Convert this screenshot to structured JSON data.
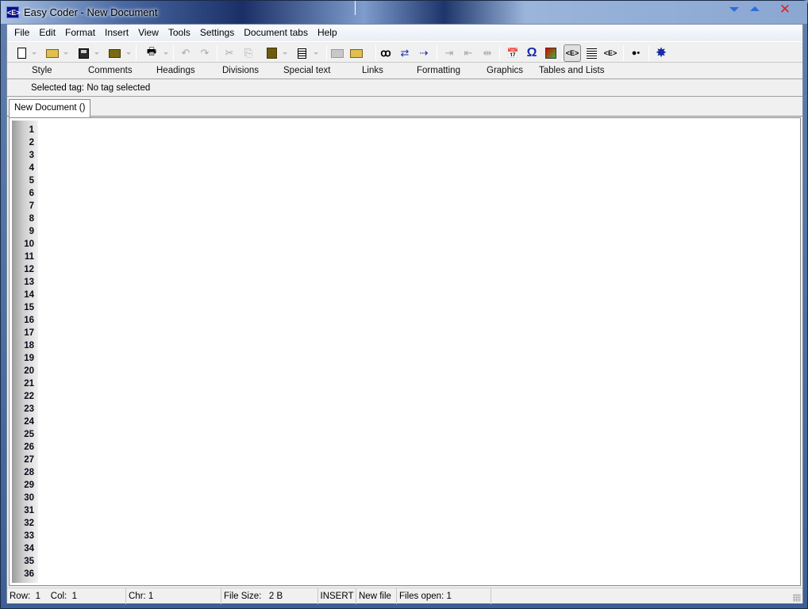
{
  "window": {
    "title": "Easy Coder - New Document",
    "app_icon": "easy-coder-logo-icon",
    "app_icon_text": "<E>",
    "controls": [
      "minimize-icon",
      "maximize-icon",
      "close-icon"
    ],
    "close_glyph": "✕"
  },
  "menu": {
    "items": [
      "File",
      "Edit",
      "Format",
      "Insert",
      "View",
      "Tools",
      "Settings",
      "Document tabs",
      "Help"
    ]
  },
  "toolbar": {
    "buttons": [
      {
        "name": "new-document",
        "icon": "new-document-icon",
        "enabled": true,
        "dropdown": true
      },
      {
        "name": "open",
        "icon": "open-folder-icon",
        "enabled": true,
        "dropdown": true
      },
      {
        "name": "save",
        "icon": "save-floppy-icon",
        "enabled": true,
        "dropdown": true
      },
      {
        "name": "save-to-server",
        "icon": "upload-folder-icon",
        "enabled": true,
        "dropdown": true
      },
      {
        "name": "print",
        "icon": "printer-icon",
        "enabled": true,
        "dropdown": true
      },
      {
        "name": "undo",
        "icon": "undo-icon",
        "enabled": false,
        "glyph": "↶"
      },
      {
        "name": "redo",
        "icon": "redo-icon",
        "enabled": false,
        "glyph": "↷"
      },
      {
        "name": "cut",
        "icon": "scissors-icon",
        "enabled": false,
        "glyph": "✂"
      },
      {
        "name": "copy",
        "icon": "copy-icon",
        "enabled": false,
        "glyph": "⎘"
      },
      {
        "name": "paste",
        "icon": "paste-icon",
        "enabled": true,
        "dropdown": true,
        "glyph": "📋"
      },
      {
        "name": "document-list",
        "icon": "document-lines-icon",
        "enabled": true,
        "dropdown": true
      },
      {
        "name": "import",
        "icon": "folder-import-icon",
        "enabled": false
      },
      {
        "name": "export",
        "icon": "folder-export-icon",
        "enabled": true
      },
      {
        "name": "find",
        "icon": "binoculars-icon",
        "enabled": true,
        "glyph": "🔭"
      },
      {
        "name": "replace",
        "icon": "find-replace-icon",
        "enabled": true,
        "glyph": "⇄"
      },
      {
        "name": "find-next",
        "icon": "find-next-icon",
        "enabled": true,
        "glyph": "⇢"
      },
      {
        "name": "indent",
        "icon": "indent-icon",
        "enabled": false,
        "glyph": "⇥"
      },
      {
        "name": "outdent",
        "icon": "outdent-icon",
        "enabled": false,
        "glyph": "⇤"
      },
      {
        "name": "block-indent",
        "icon": "block-indent-icon",
        "enabled": false,
        "glyph": "⇹"
      },
      {
        "name": "insert-date",
        "icon": "calendar-clock-icon",
        "enabled": true,
        "glyph": "📅"
      },
      {
        "name": "special-characters",
        "icon": "omega-icon",
        "enabled": true,
        "glyph": "Ω"
      },
      {
        "name": "color-picker",
        "icon": "color-swatch-icon",
        "enabled": true
      },
      {
        "name": "tag-mode",
        "icon": "tag-brackets-icon",
        "enabled": true,
        "pressed": true,
        "glyph": "<E>"
      },
      {
        "name": "outline-view",
        "icon": "outline-list-icon",
        "enabled": true
      },
      {
        "name": "tag-outline",
        "icon": "tag-outline-icon",
        "enabled": true,
        "glyph": "<E>"
      },
      {
        "name": "bullet-toggle",
        "icon": "bullet-dots-icon",
        "enabled": true,
        "glyph": "●•"
      },
      {
        "name": "validate",
        "icon": "burst-star-icon",
        "enabled": true,
        "glyph": "✸"
      }
    ]
  },
  "tag_categories": [
    "Style",
    "Comments",
    "Headings",
    "Divisions",
    "Special text",
    "Links",
    "Formatting",
    "Graphics",
    "Tables and Lists"
  ],
  "selected_tag": "Selected tag: No tag selected",
  "tabs": [
    {
      "label": "New Document ()",
      "active": true
    }
  ],
  "editor": {
    "line_numbers": [
      "1",
      "2",
      "3",
      "4",
      "5",
      "6",
      "7",
      "8",
      "9",
      "10",
      "11",
      "12",
      "13",
      "14",
      "15",
      "16",
      "17",
      "18",
      "19",
      "20",
      "21",
      "22",
      "23",
      "24",
      "25",
      "26",
      "27",
      "28",
      "29",
      "30",
      "31",
      "32",
      "33",
      "34",
      "35",
      "36"
    ],
    "content": ""
  },
  "status": {
    "row_col": "Row:  1    Col:  1",
    "chr": "Chr: 1",
    "file_size": "File Size:   2 B",
    "mode": "INSERT",
    "file_state": "New file",
    "files_open": "Files open: 1"
  }
}
